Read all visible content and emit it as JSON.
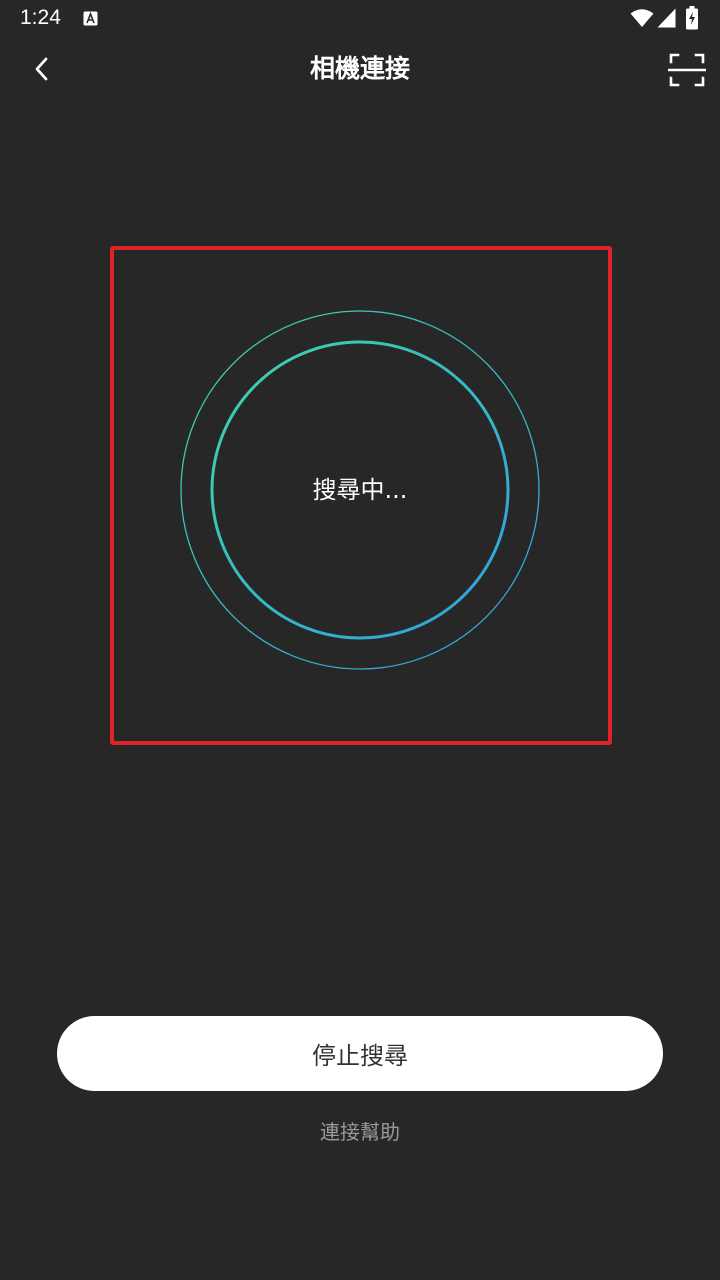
{
  "status_bar": {
    "time": "1:24",
    "icons": [
      "app-notification-icon",
      "wifi-icon",
      "signal-icon",
      "battery-charging-icon"
    ]
  },
  "header": {
    "title": "相機連接",
    "back_icon": "chevron-left-icon",
    "scan_icon": "scan-icon"
  },
  "search": {
    "status_text": "搜尋中...",
    "frame_color": "#e0222a",
    "ring_gradient": [
      "#3fd4a6",
      "#2f9fe0"
    ]
  },
  "actions": {
    "stop_label": "停止搜尋",
    "help_label": "連接幫助"
  },
  "colors": {
    "background": "#272727",
    "button_bg": "#ffffff",
    "help_text": "#9a9a9a"
  }
}
